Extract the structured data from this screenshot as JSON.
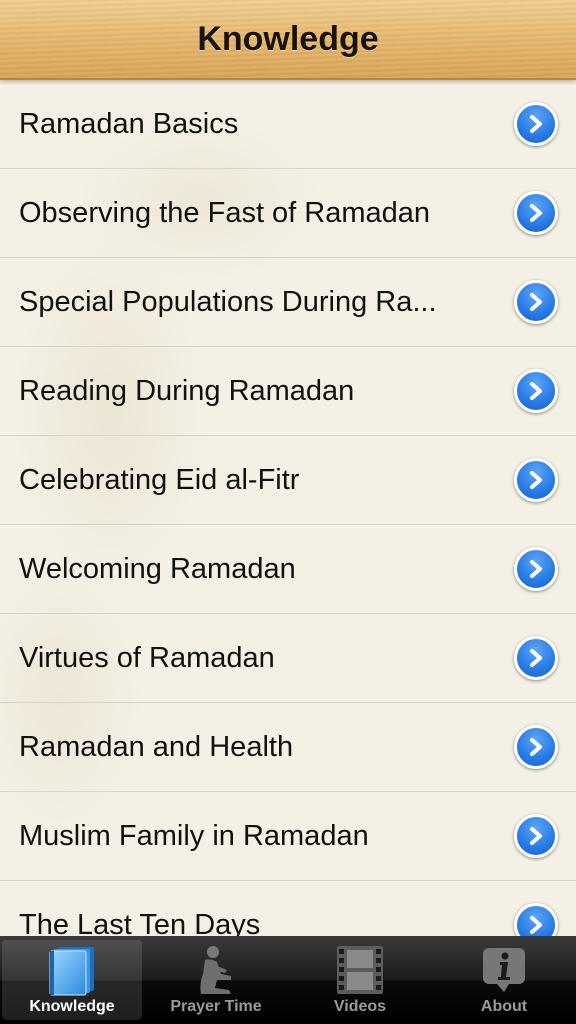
{
  "navbar": {
    "title": "Knowledge"
  },
  "list": {
    "items": [
      {
        "label": "Ramadan Basics"
      },
      {
        "label": "Observing the Fast of Ramadan"
      },
      {
        "label": "Special Populations During Ra..."
      },
      {
        "label": "Reading During Ramadan"
      },
      {
        "label": "Celebrating Eid al-Fitr"
      },
      {
        "label": "Welcoming Ramadan"
      },
      {
        "label": "Virtues of Ramadan"
      },
      {
        "label": "Ramadan and Health"
      },
      {
        "label": "Muslim Family in Ramadan"
      },
      {
        "label": "The Last Ten Days"
      }
    ],
    "disclosure_icon": "chevron-right-circle-icon",
    "accent_color": "#2a7ee8"
  },
  "tabbar": {
    "tabs": [
      {
        "label": "Knowledge",
        "icon": "book-icon",
        "active": true
      },
      {
        "label": "Prayer Time",
        "icon": "praying-person-icon",
        "active": false
      },
      {
        "label": "Videos",
        "icon": "film-strip-icon",
        "active": false
      },
      {
        "label": "About",
        "icon": "info-bubble-icon",
        "active": false
      }
    ]
  }
}
